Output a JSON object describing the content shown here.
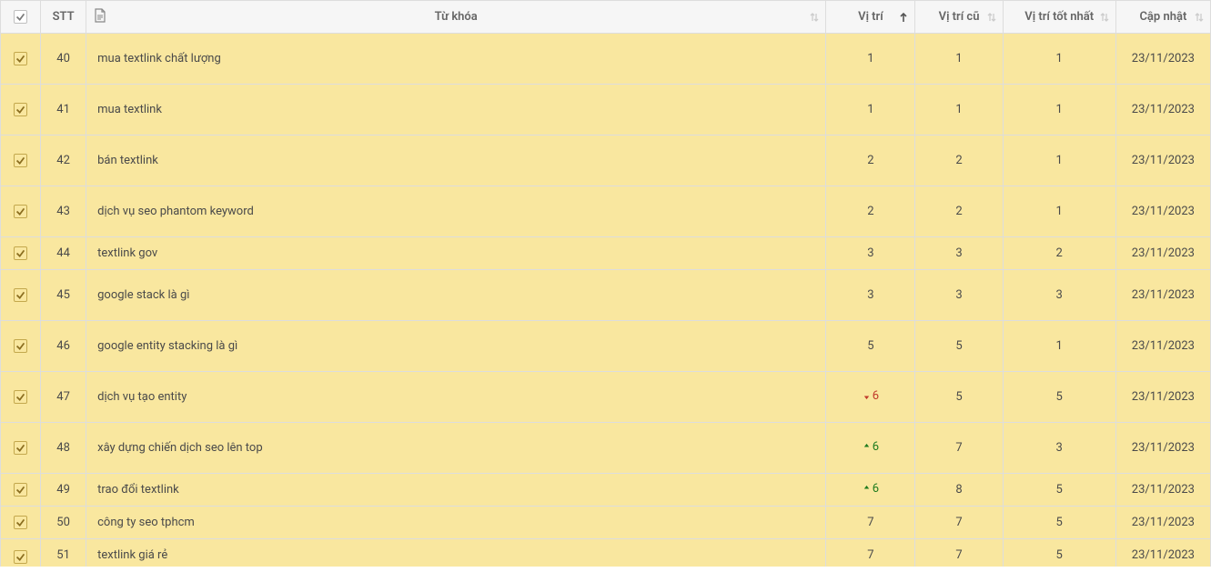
{
  "headers": {
    "stt": "STT",
    "keyword": "Từ khóa",
    "position": "Vị trí",
    "old_position": "Vị trí cũ",
    "best_position": "Vị trí tốt nhất",
    "updated": "Cập nhật"
  },
  "rows": [
    {
      "stt": "40",
      "keyword": "mua textlink chất lượng",
      "pos": "1",
      "trend": "none",
      "old": "1",
      "best": "1",
      "updated": "23/11/2023",
      "height": "tall"
    },
    {
      "stt": "41",
      "keyword": "mua textlink",
      "pos": "1",
      "trend": "none",
      "old": "1",
      "best": "1",
      "updated": "23/11/2023",
      "height": "tall"
    },
    {
      "stt": "42",
      "keyword": "bán textlink",
      "pos": "2",
      "trend": "none",
      "old": "2",
      "best": "1",
      "updated": "23/11/2023",
      "height": "tall"
    },
    {
      "stt": "43",
      "keyword": "dịch vụ seo phantom keyword",
      "pos": "2",
      "trend": "none",
      "old": "2",
      "best": "1",
      "updated": "23/11/2023",
      "height": "tall"
    },
    {
      "stt": "44",
      "keyword": "textlink gov",
      "pos": "3",
      "trend": "none",
      "old": "3",
      "best": "2",
      "updated": "23/11/2023",
      "height": "short"
    },
    {
      "stt": "45",
      "keyword": "google stack là gì",
      "pos": "3",
      "trend": "none",
      "old": "3",
      "best": "3",
      "updated": "23/11/2023",
      "height": "tall"
    },
    {
      "stt": "46",
      "keyword": "google entity stacking là gì",
      "pos": "5",
      "trend": "none",
      "old": "5",
      "best": "1",
      "updated": "23/11/2023",
      "height": "tall"
    },
    {
      "stt": "47",
      "keyword": "dịch vụ tạo entity",
      "pos": "6",
      "trend": "down",
      "old": "5",
      "best": "5",
      "updated": "23/11/2023",
      "height": "tall"
    },
    {
      "stt": "48",
      "keyword": "xây dựng chiến dịch seo lên top",
      "pos": "6",
      "trend": "up",
      "old": "7",
      "best": "3",
      "updated": "23/11/2023",
      "height": "tall"
    },
    {
      "stt": "49",
      "keyword": "trao đổi textlink",
      "pos": "6",
      "trend": "up",
      "old": "8",
      "best": "5",
      "updated": "23/11/2023",
      "height": "short"
    },
    {
      "stt": "50",
      "keyword": "công ty seo tphcm",
      "pos": "7",
      "trend": "none",
      "old": "7",
      "best": "5",
      "updated": "23/11/2023",
      "height": "short"
    },
    {
      "stt": "51",
      "keyword": "textlink giá rẻ",
      "pos": "7",
      "trend": "none",
      "old": "7",
      "best": "5",
      "updated": "23/11/2023",
      "height": "last"
    }
  ]
}
